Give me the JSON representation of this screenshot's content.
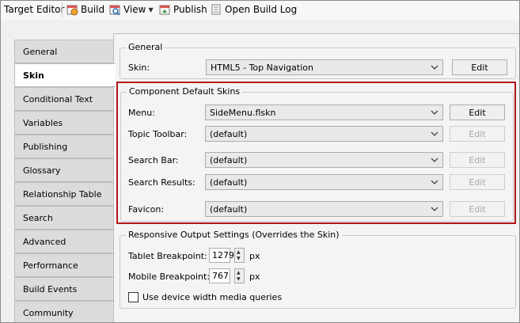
{
  "toolbar": {
    "target_editor": "Target Editor",
    "build": "Build",
    "view": "View",
    "publish": "Publish",
    "open_build_log": "Open Build Log"
  },
  "nav": {
    "items": [
      {
        "label": "General",
        "active": false
      },
      {
        "label": "Skin",
        "active": true
      },
      {
        "label": "Conditional Text",
        "active": false
      },
      {
        "label": "Variables",
        "active": false
      },
      {
        "label": "Publishing",
        "active": false
      },
      {
        "label": "Glossary",
        "active": false
      },
      {
        "label": "Relationship Table",
        "active": false
      },
      {
        "label": "Search",
        "active": false
      },
      {
        "label": "Advanced",
        "active": false
      },
      {
        "label": "Performance",
        "active": false
      },
      {
        "label": "Build Events",
        "active": false
      },
      {
        "label": "Community",
        "active": false
      }
    ]
  },
  "general_group": {
    "title": "General",
    "skin_label": "Skin:",
    "skin_value": "HTML5 - Top Navigation",
    "edit_label": "Edit"
  },
  "component_group": {
    "title": "Component Default Skins",
    "rows": [
      {
        "label": "Menu:",
        "value": "SideMenu.flskn",
        "edit": "Edit",
        "enabled": true
      },
      {
        "label": "Topic Toolbar:",
        "value": "(default)",
        "edit": "Edit",
        "enabled": false
      },
      {
        "label": "Search Bar:",
        "value": "(default)",
        "edit": "Edit",
        "enabled": false
      },
      {
        "label": "Search Results:",
        "value": "(default)",
        "edit": "Edit",
        "enabled": false
      },
      {
        "label": "Favicon:",
        "value": "(default)",
        "edit": "Edit",
        "enabled": false
      }
    ]
  },
  "responsive_group": {
    "title": "Responsive Output Settings (Overrides the Skin)",
    "tablet_label": "Tablet Breakpoint:",
    "tablet_value": "1279",
    "mobile_label": "Mobile Breakpoint:",
    "mobile_value": "767",
    "unit": "px",
    "checkbox_label": "Use device width media queries",
    "checkbox_checked": false
  },
  "colors": {
    "highlight_border": "#b0141b"
  }
}
